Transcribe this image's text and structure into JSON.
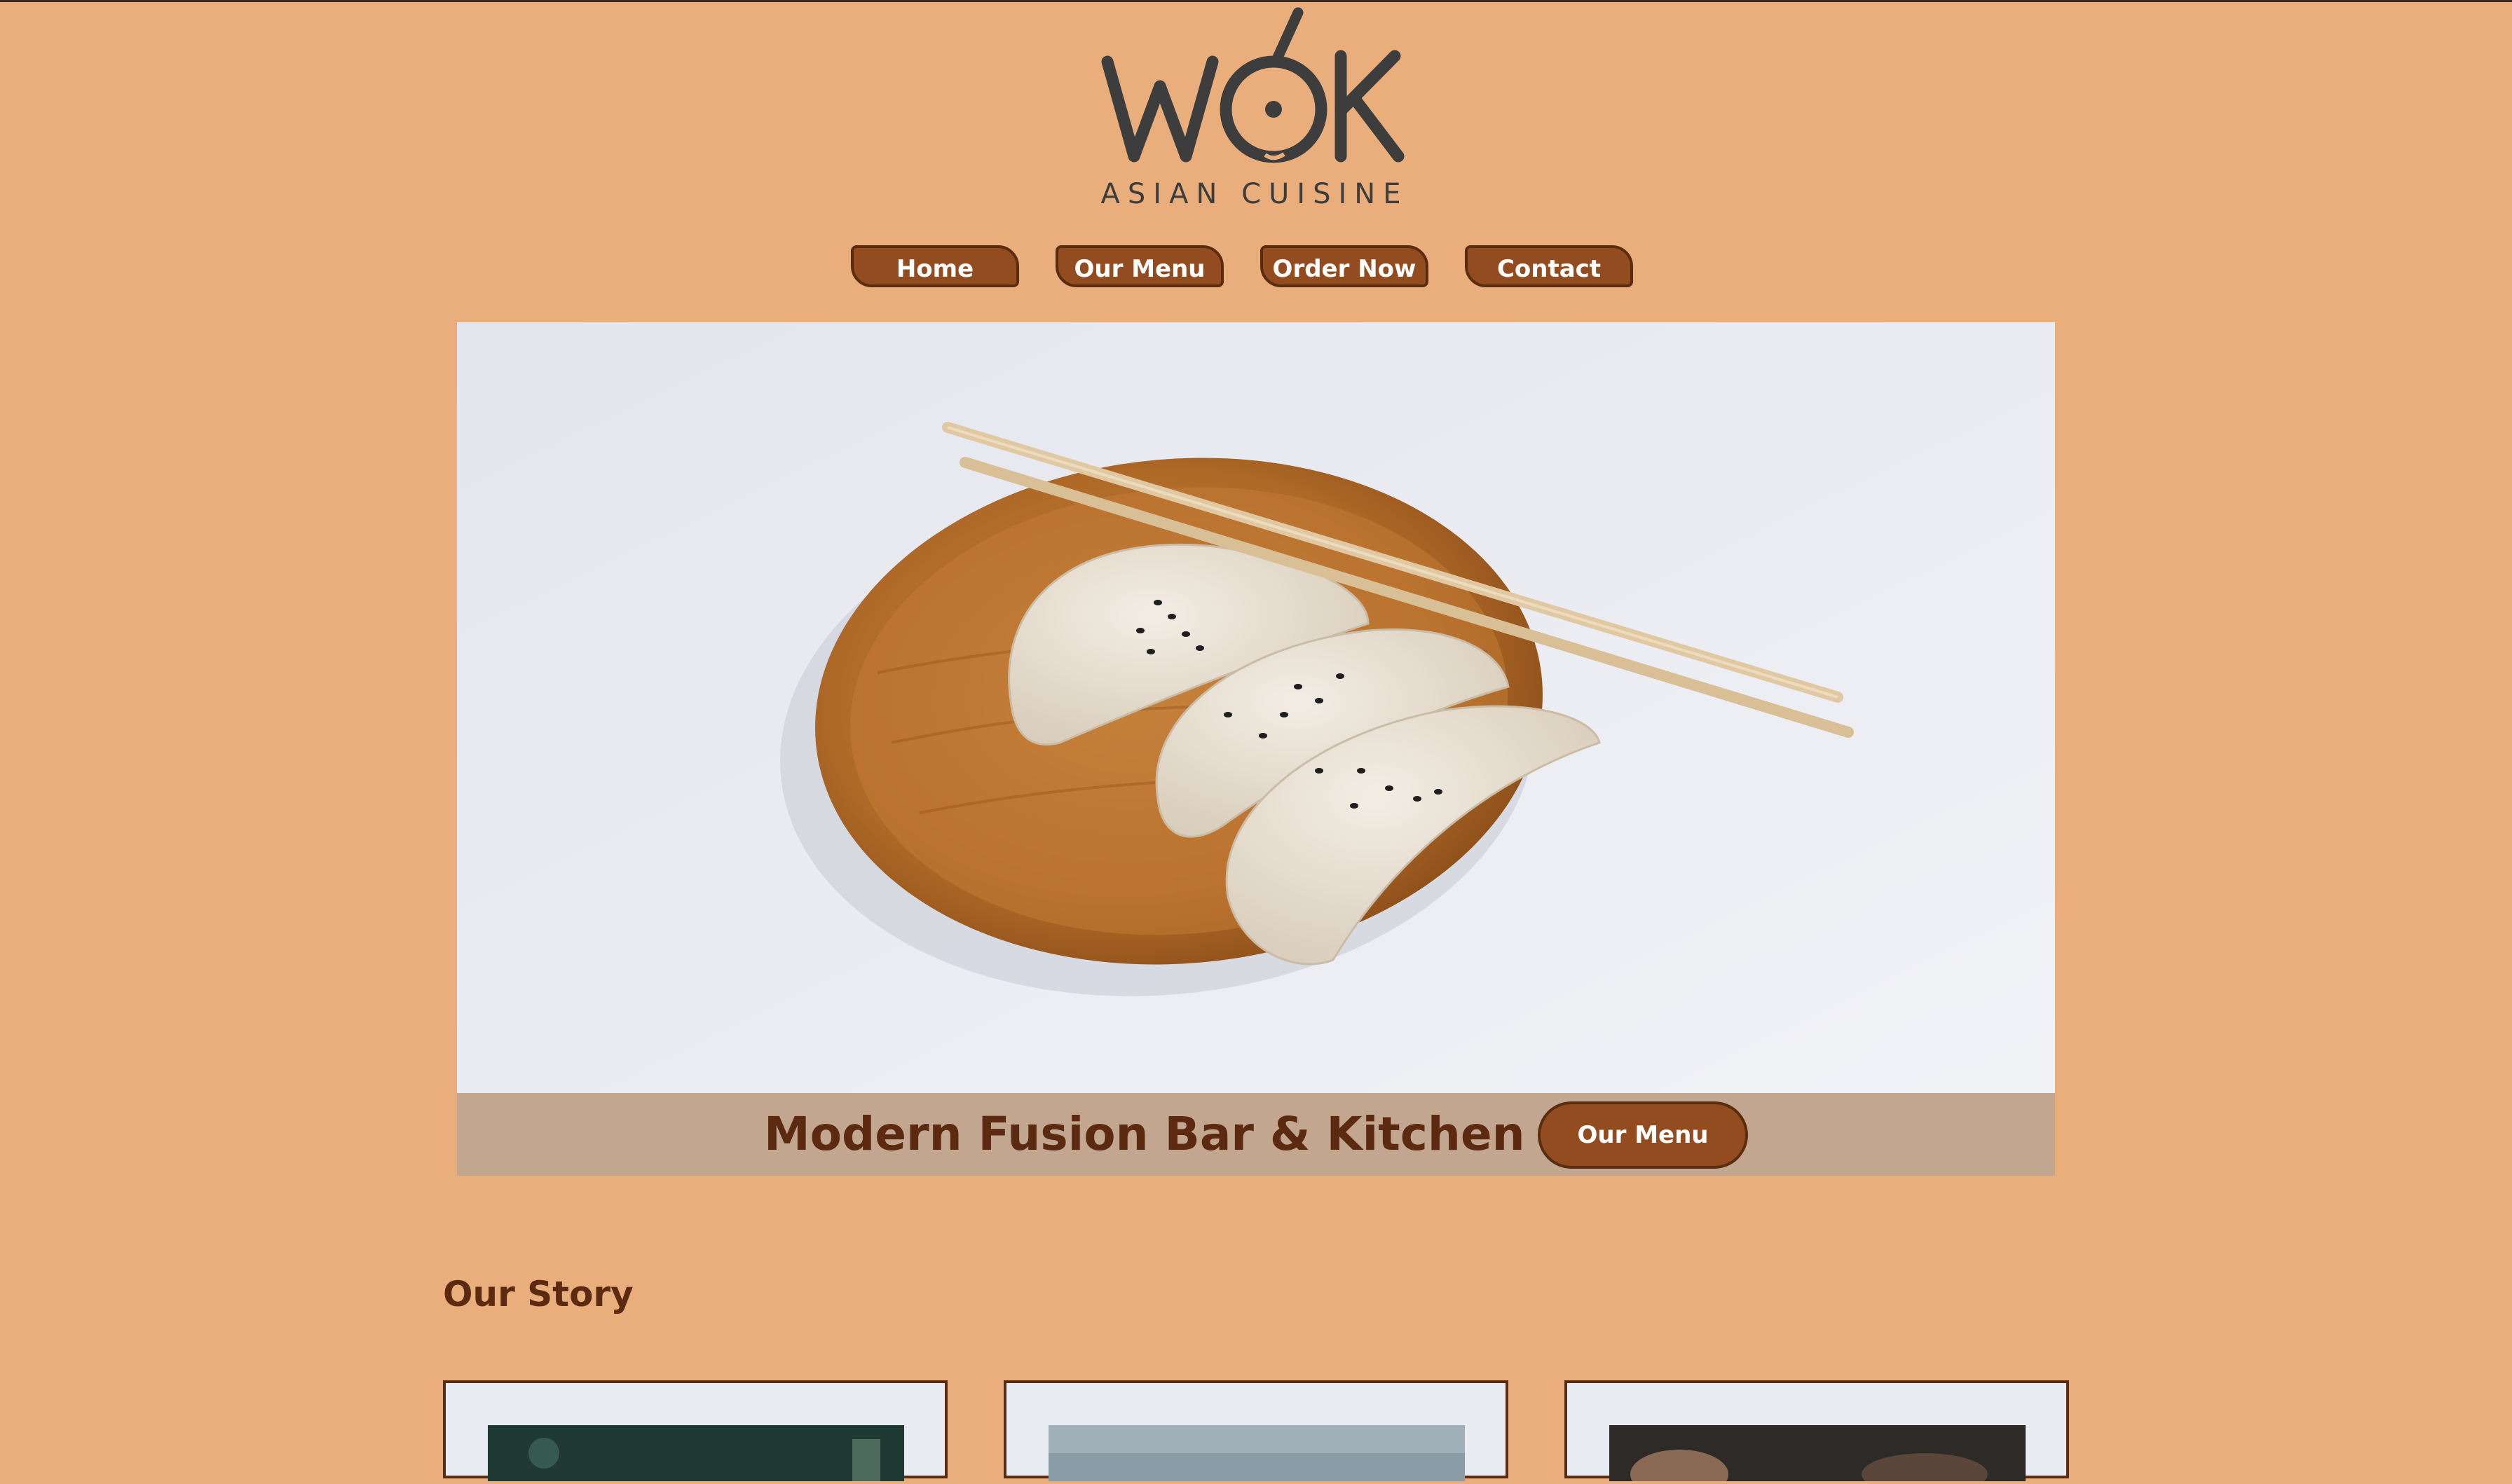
{
  "brand": {
    "logo_word": "WOK",
    "logo_tagline": "ASIAN CUISINE"
  },
  "nav": {
    "items": [
      {
        "label": "Home"
      },
      {
        "label": "Our Menu"
      },
      {
        "label": "Order Now"
      },
      {
        "label": "Contact"
      }
    ]
  },
  "hero": {
    "title": "Modern Fusion Bar & Kitchen",
    "button_label": "Our Menu"
  },
  "story": {
    "heading": "Our Story",
    "cards": [
      {
        "image_tone": "#1f3a33"
      },
      {
        "image_tone": "#9fb0b8"
      },
      {
        "image_tone": "#2d2a28"
      }
    ]
  },
  "colors": {
    "page_background": "#e9ae7b",
    "button_fill": "#934c1f",
    "button_border": "#5b2d10",
    "heading_text": "#5b2a10",
    "hero_band": "#c3a690",
    "logo_ink": "#3d3d3d"
  }
}
